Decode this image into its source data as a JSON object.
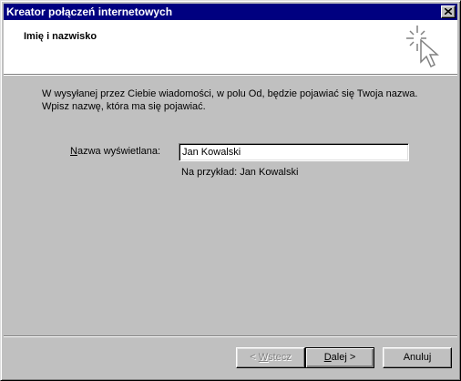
{
  "window": {
    "title": "Kreator połączeń internetowych"
  },
  "header": {
    "title": "Imię i nazwisko",
    "icon": "wizard-sparkle-cursor-icon"
  },
  "description": {
    "line1": "W wysyłanej przez Ciebie wiadomości, w polu Od, będzie pojawiać się Twoja nazwa.",
    "line2": "Wpisz nazwę, która ma się pojawiać."
  },
  "form": {
    "label_prefix": "N",
    "label_rest": "azwa wyświetlana:",
    "name_value": "Jan Kowalski",
    "example": "Na przykład: Jan Kowalski"
  },
  "buttons": {
    "back_prefix": "< ",
    "back_mnemonic": "W",
    "back_rest": "stecz",
    "next_mnemonic": "D",
    "next_rest": "alej >",
    "cancel": "Anuluj"
  },
  "colors": {
    "titlebar": "#000080",
    "face": "#c0c0c0",
    "header_bg": "#ffffff"
  }
}
